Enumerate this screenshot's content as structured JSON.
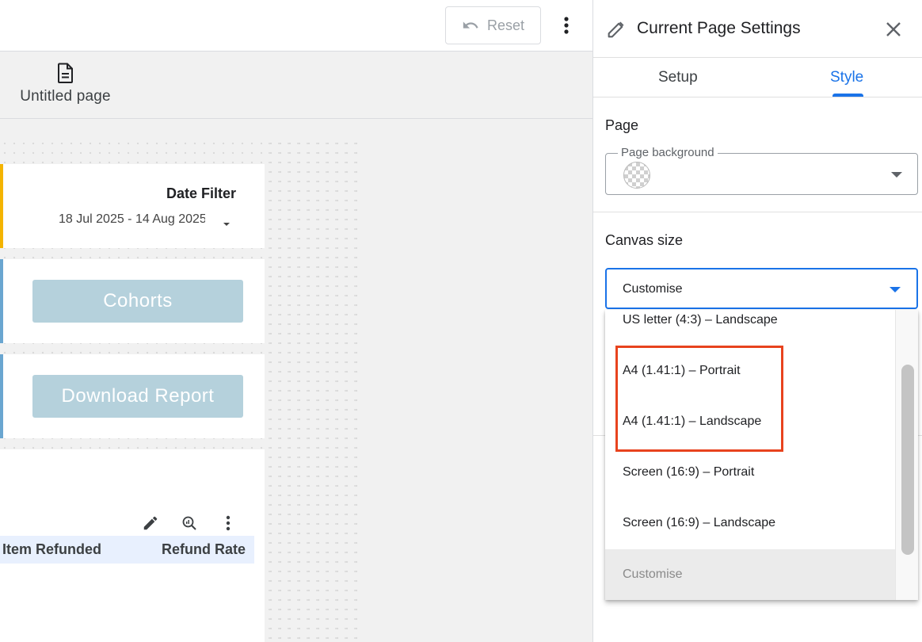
{
  "toolbar": {
    "reset_label": "Reset"
  },
  "page_tab": {
    "label": "Untitled page"
  },
  "canvas": {
    "date_filter": {
      "title": "Date Filter",
      "range": "18 Jul 2025 - 14 Aug 2025"
    },
    "cohorts_button": "Cohorts",
    "download_button": "Download Report",
    "table": {
      "columns": [
        "Item Refunded",
        "Refund Rate"
      ]
    }
  },
  "panel": {
    "title": "Current Page Settings",
    "tabs": [
      {
        "label": "Setup",
        "active": false
      },
      {
        "label": "Style",
        "active": true
      }
    ],
    "page_section": {
      "heading": "Page",
      "background_label": "Page background"
    },
    "canvas_section": {
      "heading": "Canvas size",
      "selected": "Customise",
      "options": [
        "US letter (4:3) – Landscape",
        "A4 (1.41:1) – Portrait",
        "A4 (1.41:1) – Landscape",
        "Screen (16:9) – Portrait",
        "Screen (16:9) – Landscape",
        "Customise"
      ]
    }
  },
  "colors": {
    "accent": "#1a73e8",
    "date_card_accent": "#f4b400",
    "button_blue": "#b5d1dc",
    "highlight": "#e8431e"
  },
  "icons": [
    "undo-icon",
    "more-vert-icon",
    "document-icon",
    "pencil-icon",
    "close-icon",
    "explore-icon",
    "dropdown-caret-icon"
  ]
}
